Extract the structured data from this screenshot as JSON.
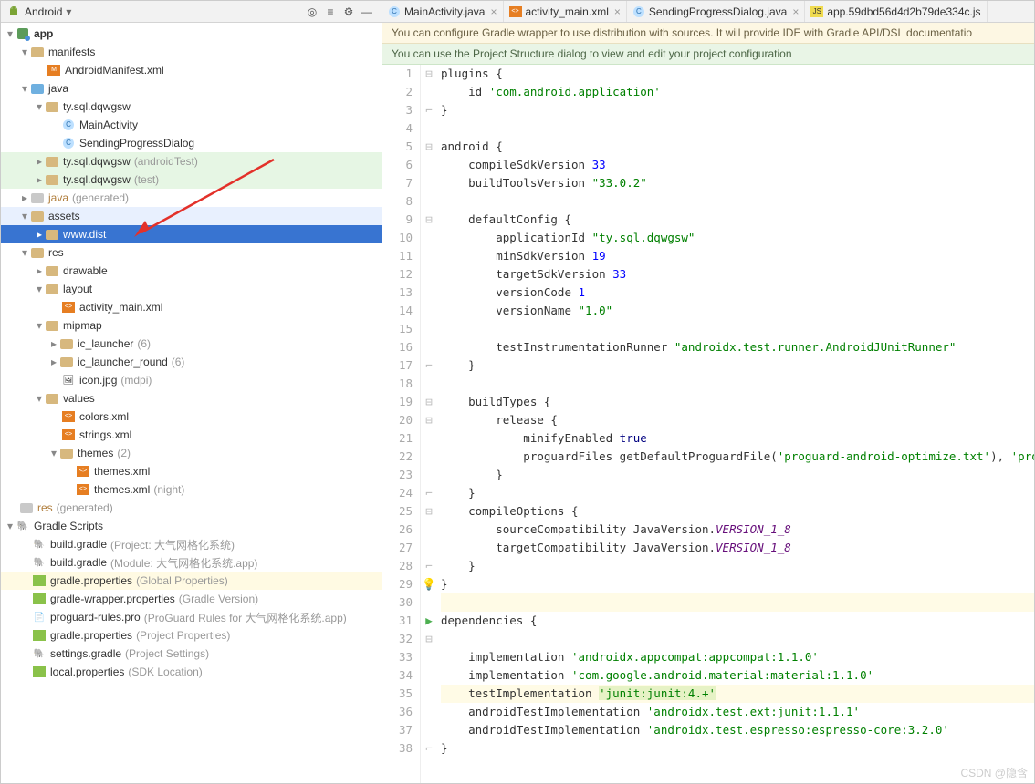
{
  "toolbar": {
    "title": "Android"
  },
  "tree": {
    "app": "app",
    "manifests": "manifests",
    "manifest_file": "AndroidManifest.xml",
    "java": "java",
    "pkg_main": "ty.sql.dqwgsw",
    "main_activity": "MainActivity",
    "sending_dialog": "SendingProgressDialog",
    "pkg_android_test": "ty.sql.dqwgsw",
    "pkg_android_test_hint": "(androidTest)",
    "pkg_test": "ty.sql.dqwgsw",
    "pkg_test_hint": "(test)",
    "java_gen": "java",
    "java_gen_hint": "(generated)",
    "assets": "assets",
    "www_dist": "www.dist",
    "res": "res",
    "drawable": "drawable",
    "layout": "layout",
    "activity_main_xml": "activity_main.xml",
    "mipmap": "mipmap",
    "ic_launcher": "ic_launcher",
    "ic_launcher_hint": "(6)",
    "ic_launcher_round": "ic_launcher_round",
    "ic_launcher_round_hint": "(6)",
    "icon_jpg": "icon.jpg",
    "icon_jpg_hint": "(mdpi)",
    "values": "values",
    "colors_xml": "colors.xml",
    "strings_xml": "strings.xml",
    "themes": "themes",
    "themes_hint": "(2)",
    "themes_xml": "themes.xml",
    "themes_night": "themes.xml",
    "themes_night_hint": "(night)",
    "res_gen": "res",
    "res_gen_hint": "(generated)",
    "gradle_scripts": "Gradle Scripts",
    "bg_proj": "build.gradle",
    "bg_proj_hint": "(Project: 大气网格化系统)",
    "bg_mod": "build.gradle",
    "bg_mod_hint": "(Module: 大气网格化系统.app)",
    "gp_global": "gradle.properties",
    "gp_global_hint": "(Global Properties)",
    "gw_prop": "gradle-wrapper.properties",
    "gw_prop_hint": "(Gradle Version)",
    "proguard": "proguard-rules.pro",
    "proguard_hint": "(ProGuard Rules for 大气网格化系统.app)",
    "gp_proj": "gradle.properties",
    "gp_proj_hint": "(Project Properties)",
    "settings": "settings.gradle",
    "settings_hint": "(Project Settings)",
    "local_prop": "local.properties",
    "local_prop_hint": "(SDK Location)"
  },
  "tabs": [
    {
      "label": "MainActivity.java",
      "icon": "java"
    },
    {
      "label": "activity_main.xml",
      "icon": "xml"
    },
    {
      "label": "SendingProgressDialog.java",
      "icon": "java"
    },
    {
      "label": "app.59dbd56d4d2b79de334c.js",
      "icon": "js"
    }
  ],
  "banners": {
    "gradle": "You can configure Gradle wrapper to use distribution with sources. It will provide IDE with Gradle API/DSL documentatio",
    "structure": "You can use the Project Structure dialog to view and edit your project configuration"
  },
  "code": {
    "lines": [
      {
        "n": 1,
        "t": "plugins {"
      },
      {
        "n": 2,
        "t": "    id <s>'com.android.application'</s>"
      },
      {
        "n": 3,
        "t": "}"
      },
      {
        "n": 4,
        "t": ""
      },
      {
        "n": 5,
        "t": "android {"
      },
      {
        "n": 6,
        "t": "    compileSdkVersion <n>33</n>"
      },
      {
        "n": 7,
        "t": "    buildToolsVersion <s>\"33.0.2\"</s>"
      },
      {
        "n": 8,
        "t": ""
      },
      {
        "n": 9,
        "t": "    defaultConfig {"
      },
      {
        "n": 10,
        "t": "        applicationId <s>\"ty.sql.dqwgsw\"</s>"
      },
      {
        "n": 11,
        "t": "        minSdkVersion <n>19</n>"
      },
      {
        "n": 12,
        "t": "        targetSdkVersion <n>33</n>"
      },
      {
        "n": 13,
        "t": "        versionCode <n>1</n>"
      },
      {
        "n": 14,
        "t": "        versionName <s>\"1.0\"</s>"
      },
      {
        "n": 15,
        "t": ""
      },
      {
        "n": 16,
        "t": "        testInstrumentationRunner <s>\"androidx.test.runner.AndroidJUnitRunner\"</s>"
      },
      {
        "n": 17,
        "t": "    }"
      },
      {
        "n": 18,
        "t": ""
      },
      {
        "n": 19,
        "t": "    buildTypes {"
      },
      {
        "n": 20,
        "t": "        release {"
      },
      {
        "n": 21,
        "t": "            minifyEnabled <k>true</k>"
      },
      {
        "n": 22,
        "t": "            proguardFiles getDefaultProguardFile(<s>'proguard-android-optimize.txt'</s>), <s>'proguard-</s>"
      },
      {
        "n": 23,
        "t": "        }"
      },
      {
        "n": 24,
        "t": "    }"
      },
      {
        "n": 25,
        "t": "    compileOptions {"
      },
      {
        "n": 26,
        "t": "        sourceCompatibility JavaVersion.<c>VERSION_1_8</c>"
      },
      {
        "n": 27,
        "t": "        targetCompatibility JavaVersion.<c>VERSION_1_8</c>"
      },
      {
        "n": 28,
        "t": "    }"
      },
      {
        "n": 29,
        "t": "}"
      },
      {
        "n": 30,
        "t": ""
      },
      {
        "n": 31,
        "t": "dependencies {"
      },
      {
        "n": 32,
        "t": ""
      },
      {
        "n": 33,
        "t": "    implementation <s>'androidx.appcompat:appcompat:1.1.0'</s>"
      },
      {
        "n": 34,
        "t": "    implementation <s>'com.google.android.material:material:1.1.0'</s>"
      },
      {
        "n": 35,
        "t": "    testImplementation <sh>'junit:junit:4.+'</sh>"
      },
      {
        "n": 36,
        "t": "    androidTestImplementation <s>'androidx.test.ext:junit:1.1.1'</s>"
      },
      {
        "n": 37,
        "t": "    androidTestImplementation <s>'androidx.test.espresso:espresso-core:3.2.0'</s>"
      },
      {
        "n": 38,
        "t": "}"
      }
    ]
  },
  "watermark": "CSDN @隐含"
}
